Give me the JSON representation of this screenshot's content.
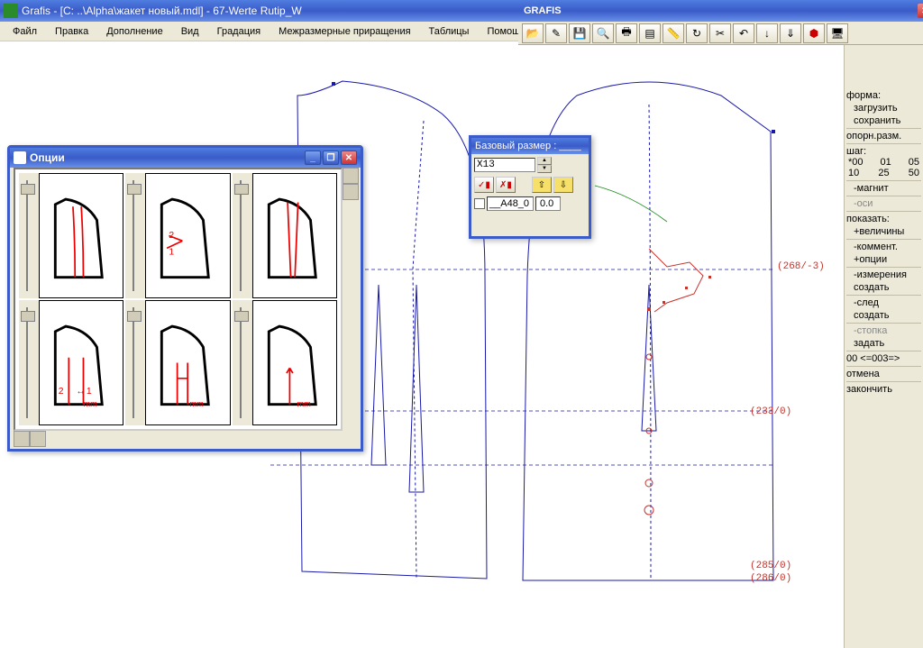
{
  "title": "Grafis - [C: ..\\Alpha\\жакет новый.mdl] - 67-Werte Rutip_W",
  "palette_title": "GRAFIS",
  "menu": [
    "Файл",
    "Правка",
    "Дополнение",
    "Вид",
    "Градация",
    "Межразмерные приращения",
    "Таблицы",
    "Помощь"
  ],
  "toolbar_icons": [
    "open-folder-icon",
    "new-icon",
    "save-icon",
    "search-icon",
    "print-icon",
    "stack-icon",
    "ruler-icon",
    "refresh-icon",
    "scissors-icon",
    "undo-icon",
    "down-arrow-icon",
    "down-arrow2-icon",
    "stop-icon",
    "screen-icon"
  ],
  "options_win": {
    "title": "Опции",
    "thumb_labels": [
      "",
      "",
      "",
      "2↔1mm",
      "mm",
      "mm"
    ]
  },
  "size_win": {
    "title": "Базовый размер : ____",
    "x_value": "X13",
    "param_name": "__A48_0",
    "param_value": "0.0"
  },
  "rpanel": {
    "forma": "форма:",
    "load": "загрузить",
    "save": "сохранить",
    "ref": "опорн.разм.",
    "step": "шаг:",
    "row1": [
      "*00",
      "01",
      "05"
    ],
    "row2": [
      "10",
      "25",
      "50"
    ],
    "magnet": "-магнит",
    "axes": "-оси",
    "show": "показать:",
    "values": "+величины",
    "comment": "-коммент.",
    "options": "+опции",
    "measure": "-измерения",
    "create": "создать",
    "trace": "-след",
    "create2": "создать",
    "stack": "-стопка",
    "set": "задать",
    "counter": "00 <=003=>",
    "cancel": "отмена",
    "finish": "закончить"
  },
  "annotations": {
    "a1": "(268/-3)",
    "a2": "(233/0)",
    "a3": "(285/0)",
    "a4": "(286/0)"
  }
}
